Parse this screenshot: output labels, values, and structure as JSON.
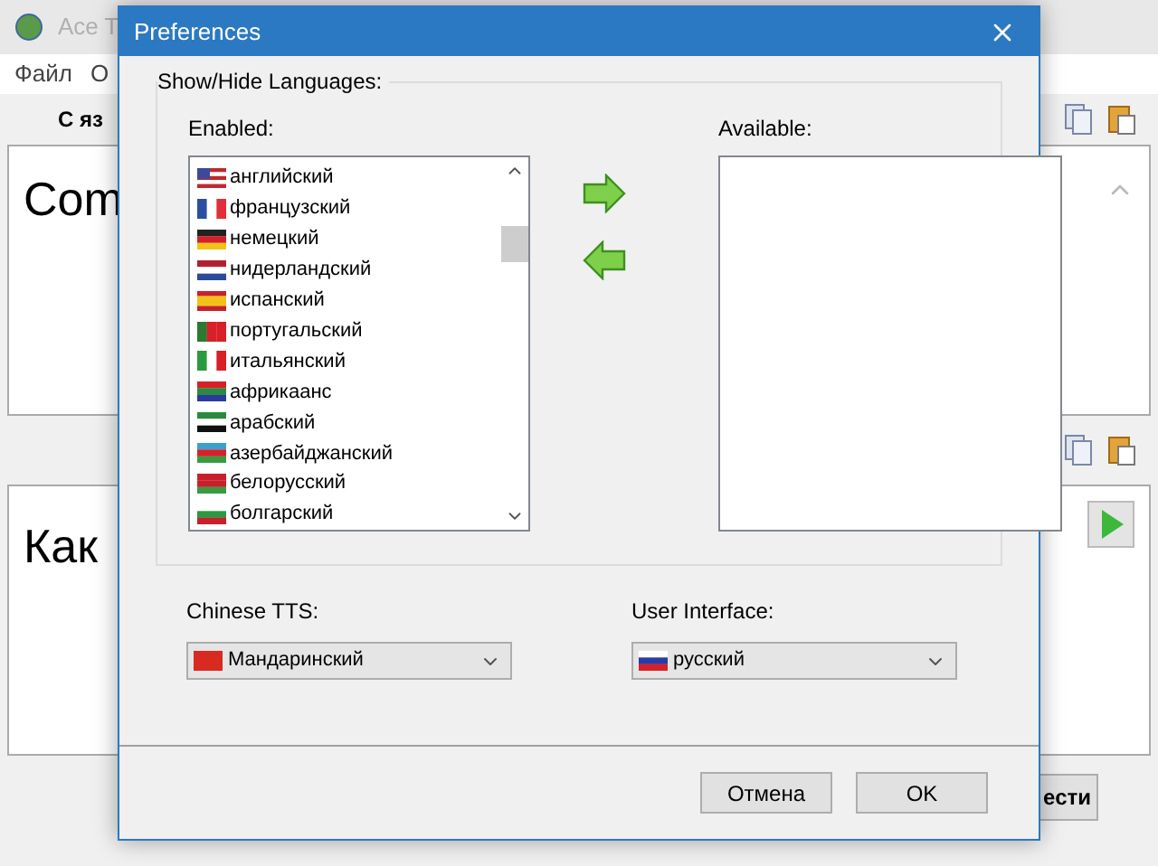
{
  "background_window": {
    "title": "Ace T",
    "menu": [
      "Файл",
      "О"
    ],
    "toolbar_label": "С яз",
    "upper_text": "Com",
    "lower_text": "Как",
    "button": "ести"
  },
  "dialog": {
    "title": "Preferences",
    "group_label": "Show/Hide Languages:",
    "enabled": {
      "label": "Enabled:",
      "items": [
        "английский",
        "французский",
        "немецкий",
        "нидерландский",
        "испанский",
        "португальский",
        "итальянский",
        "африкаанс",
        "арабский",
        "азербайджанский",
        "белорусский",
        "болгарский"
      ]
    },
    "available": {
      "label": "Available:"
    },
    "chinese_tts": {
      "label": "Chinese TTS:",
      "value": "Мандаринский"
    },
    "user_interface": {
      "label": "User Interface:",
      "value": "русский"
    },
    "buttons": [
      "Отмена",
      "OK"
    ]
  }
}
